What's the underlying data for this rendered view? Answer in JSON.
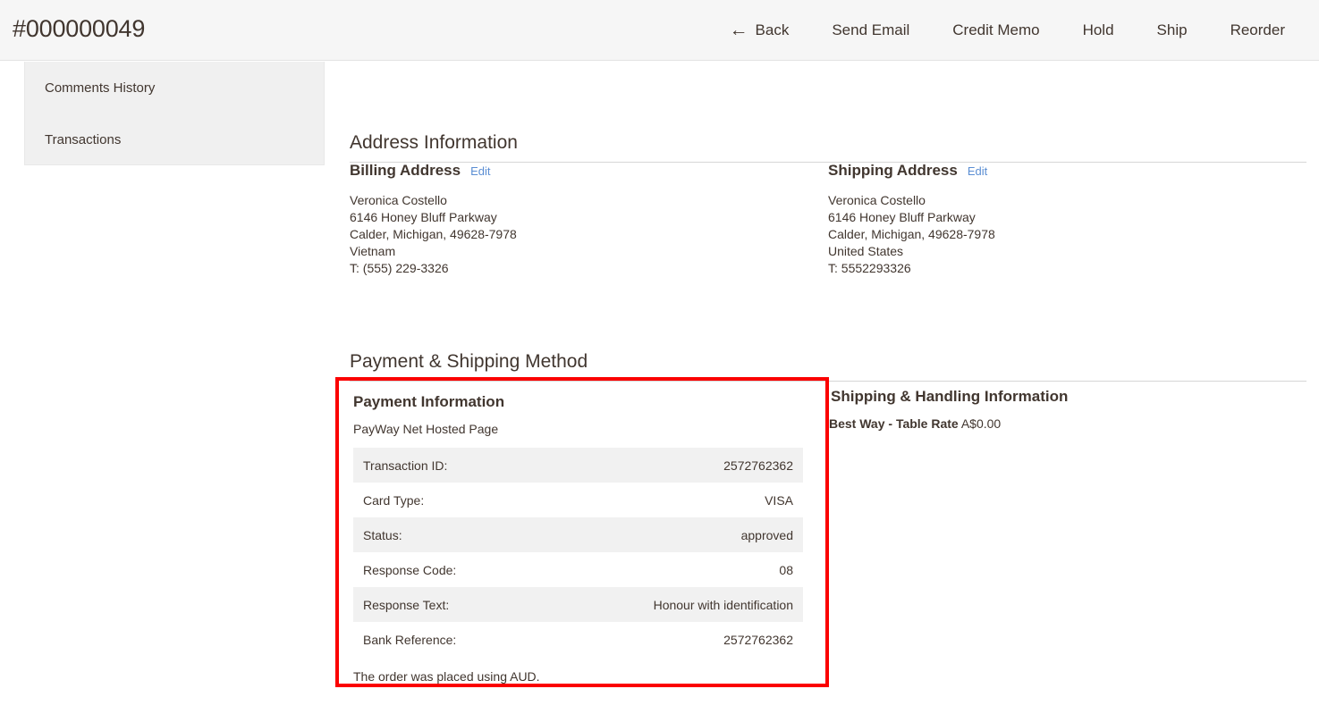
{
  "header": {
    "order_title": "#000000049",
    "actions": [
      {
        "name": "back",
        "label": "Back",
        "icon": "arrow-left-icon"
      },
      {
        "name": "send-email",
        "label": "Send Email",
        "icon": ""
      },
      {
        "name": "credit-memo",
        "label": "Credit Memo",
        "icon": ""
      },
      {
        "name": "hold",
        "label": "Hold",
        "icon": ""
      },
      {
        "name": "ship",
        "label": "Ship",
        "icon": ""
      },
      {
        "name": "reorder",
        "label": "Reorder",
        "icon": ""
      }
    ],
    "back_arrow_glyph": "←"
  },
  "sidebar": {
    "items": [
      {
        "name": "comments-history",
        "label": "Comments History"
      },
      {
        "name": "transactions",
        "label": "Transactions"
      }
    ]
  },
  "address_information": {
    "heading": "Address Information",
    "billing": {
      "title": "Billing Address",
      "edit_label": "Edit",
      "lines": "Veronica Costello\n6146 Honey Bluff Parkway\nCalder, Michigan, 49628-7978\nVietnam\nT: (555) 229-3326"
    },
    "shipping": {
      "title": "Shipping Address",
      "edit_label": "Edit",
      "lines": "Veronica Costello\n6146 Honey Bluff Parkway\nCalder, Michigan, 49628-7978\nUnited States\nT: 5552293326"
    }
  },
  "payment_shipping": {
    "heading": "Payment & Shipping Method",
    "payment": {
      "title": "Payment Information",
      "method": "PayWay Net Hosted Page",
      "rows": [
        {
          "label": "Transaction ID:",
          "value": "2572762362"
        },
        {
          "label": "Card Type:",
          "value": "VISA"
        },
        {
          "label": "Status:",
          "value": "approved"
        },
        {
          "label": "Response Code:",
          "value": "08"
        },
        {
          "label": "Response Text:",
          "value": "Honour with identification"
        },
        {
          "label": "Bank Reference:",
          "value": "2572762362"
        }
      ],
      "currency_note": "The order was placed using AUD.",
      "highlight_color": "#fb0000"
    },
    "shipping": {
      "title": "Shipping & Handling Information",
      "method_name": "Best Way - Table Rate",
      "method_price": "A$0.00"
    }
  },
  "colors": {
    "header_bg": "#f6f6f6",
    "sidebar_bg": "#f0f0f0",
    "text": "#41362f",
    "link": "#5b8ed3",
    "row_alt": "#f1f1f1",
    "highlight": "#fb0000"
  }
}
